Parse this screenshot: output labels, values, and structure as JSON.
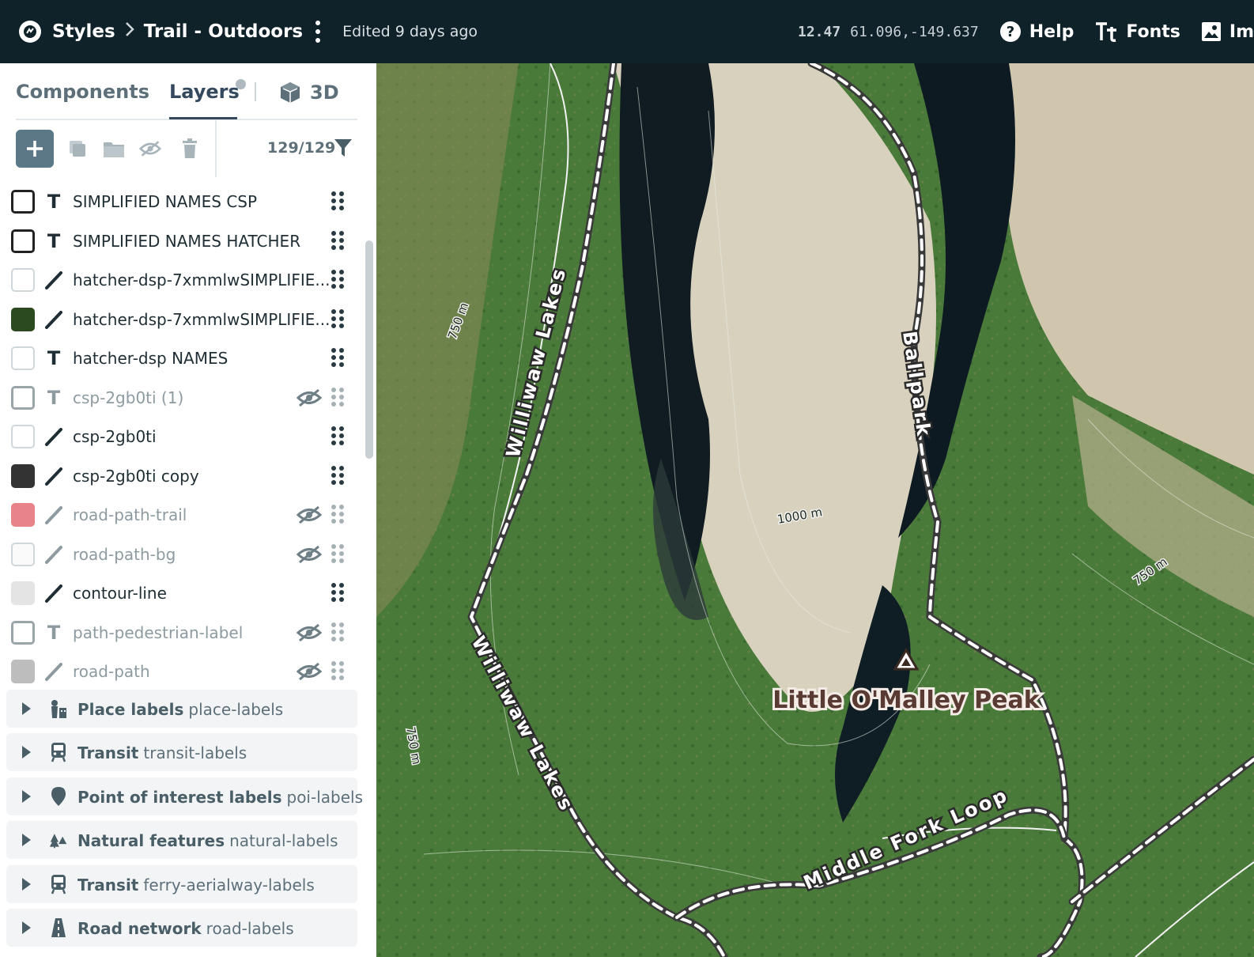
{
  "header": {
    "brand_icon": "mapbox-logo-icon",
    "breadcrumb_root": "Styles",
    "breadcrumb_sep": ">",
    "style_name": "Trail - Outdoors",
    "edited": "Edited 9 days ago",
    "zoom": "12.47",
    "coordinates": "61.096,-149.637",
    "help_label": "Help",
    "fonts_label": "Fonts",
    "images_label": "Im"
  },
  "sidebar": {
    "tabs": {
      "components": "Components",
      "layers": "Layers",
      "threed": "3D"
    },
    "toolbar": {
      "count": "129/129",
      "icons": [
        "add-icon",
        "duplicate-icon",
        "folder-icon",
        "hide-icon",
        "trash-icon",
        "filter-icon"
      ]
    },
    "layers": [
      {
        "name": "SIMPLIFIED NAMES CSP",
        "type": "text",
        "swatch": "#ffffff",
        "swatch_style": "dark-border",
        "hidden": false
      },
      {
        "name": "SIMPLIFIED NAMES HATCHER",
        "type": "text",
        "swatch": "#ffffff",
        "swatch_style": "dark-border",
        "hidden": false
      },
      {
        "name": "hatcher-dsp-7xmmlwSIMPLIFIE...",
        "type": "line",
        "swatch": "#ffffff",
        "swatch_style": "light",
        "hidden": false
      },
      {
        "name": "hatcher-dsp-7xmmlwSIMPLIFIE...",
        "type": "line",
        "swatch": "#2b4a1f",
        "swatch_style": "fill",
        "hidden": false
      },
      {
        "name": "hatcher-dsp NAMES",
        "type": "text",
        "swatch": "#ffffff",
        "swatch_style": "light",
        "hidden": false
      },
      {
        "name": "csp-2gb0ti (1)",
        "type": "text",
        "swatch": "#ffffff",
        "swatch_style": "grey-border",
        "hidden": true
      },
      {
        "name": "csp-2gb0ti",
        "type": "line",
        "swatch": "#ffffff",
        "swatch_style": "light",
        "hidden": false
      },
      {
        "name": "csp-2gb0ti copy",
        "type": "line",
        "swatch": "#333333",
        "swatch_style": "fill",
        "hidden": false
      },
      {
        "name": "road-path-trail",
        "type": "line",
        "swatch": "#e8838a",
        "swatch_style": "fill",
        "hidden": true
      },
      {
        "name": "road-path-bg",
        "type": "line",
        "swatch": "#fafafa",
        "swatch_style": "light",
        "hidden": true
      },
      {
        "name": "contour-line",
        "type": "line",
        "swatch": "#e4e4e4",
        "swatch_style": "fill",
        "hidden": false
      },
      {
        "name": "path-pedestrian-label",
        "type": "text",
        "swatch": "#ffffff",
        "swatch_style": "grey-border",
        "hidden": true
      },
      {
        "name": "road-path",
        "type": "line",
        "swatch": "#bdbdbd",
        "swatch_style": "fill",
        "hidden": true
      }
    ],
    "groups": [
      {
        "title": "Place labels",
        "id": "place-labels",
        "icon": "place-labels-icon"
      },
      {
        "title": "Transit",
        "id": "transit-labels",
        "icon": "train-icon"
      },
      {
        "title": "Point of interest labels",
        "id": "poi-labels",
        "icon": "pin-icon"
      },
      {
        "title": "Natural features",
        "id": "natural-labels",
        "icon": "trees-icon"
      },
      {
        "title": "Transit",
        "id": "ferry-aerialway-labels",
        "icon": "train-icon"
      },
      {
        "title": "Road network",
        "id": "road-labels",
        "icon": "road-icon"
      }
    ]
  },
  "map": {
    "labels": {
      "trail_williwaw_upper": "Williwaw Lakes",
      "trail_williwaw_lower": "Williwaw Lakes",
      "trail_ballpark": "Ballpark",
      "trail_middle_fork": "Middle Fork Loop",
      "peak": "Little O'Malley Peak",
      "contour_750_a": "750 m",
      "contour_750_b": "750 m",
      "contour_750_c": "750 m",
      "contour_1000": "1000 m"
    },
    "colors": {
      "forest": "#3f6b32",
      "rock": "#d8d1bd",
      "lake": "#0d1a22",
      "trail_casing": "#3a3a3a",
      "trail_dash": "#ffffff"
    }
  }
}
